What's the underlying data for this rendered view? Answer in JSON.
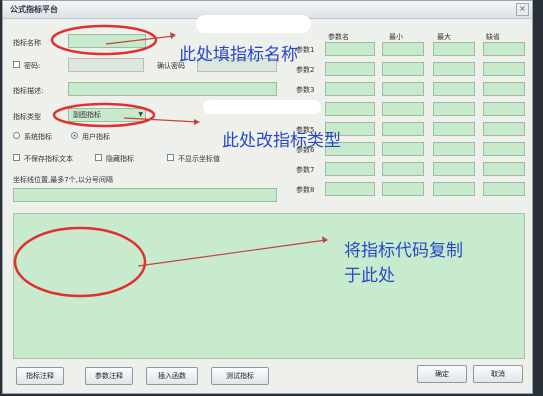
{
  "window": {
    "title": "公式指标平台",
    "close_label": "×"
  },
  "left": {
    "name_label": "指标名称",
    "password_label": "密码:",
    "confirm_label": "确认密码",
    "desc_label": "指标描述:",
    "type_label": "指标类型",
    "type_value": "副图指标",
    "radio_system": "系统指标",
    "radio_user": "用户指标",
    "chk_save_text": "不保存指标文本",
    "chk_hide": "隐藏指标",
    "chk_no_value": "不显示坐标值",
    "coord_label": "坐标线位置,最多7个,以分号间隔"
  },
  "params": {
    "headers": [
      "参数名",
      "最小",
      "最大",
      "缺省"
    ],
    "rows": [
      "参数1",
      "参数2",
      "参数3",
      "参数4",
      "参数5",
      "参数6",
      "参数7",
      "参数8"
    ]
  },
  "buttons": {
    "edit": "指标注释",
    "param_comment": "参数注释",
    "insert_func": "插入函数",
    "test": "测试指标",
    "ok": "确定",
    "cancel": "取消"
  },
  "annotations": {
    "name": "此处填指标名称",
    "type": "此处改指标类型",
    "code_line1": "将指标代码复制",
    "code_line2": "于此处"
  },
  "colors": {
    "field": "#c7e9cc",
    "annotation": "#2848c8",
    "circle": "#e03030"
  }
}
